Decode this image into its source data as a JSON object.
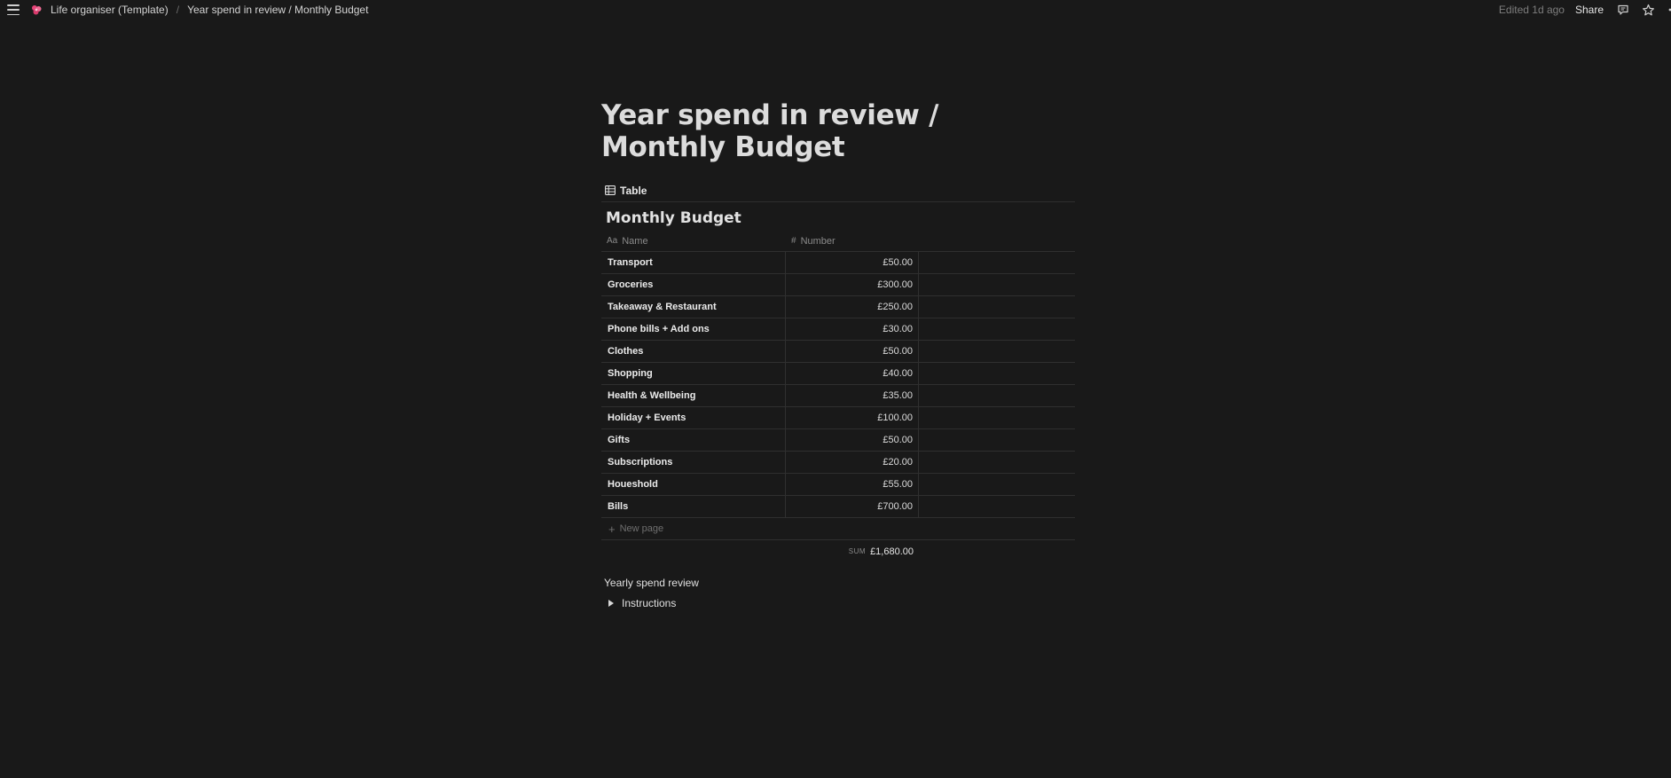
{
  "topbar": {
    "workspace_page": "Life organiser (Template)",
    "separator": "/",
    "current_page": "Year spend in review / Monthly Budget",
    "edited": "Edited 1d ago",
    "share_label": "Share",
    "icons": [
      "menu-icon",
      "page-emoji-icon",
      "comment-icon",
      "star-icon",
      "more-icon"
    ]
  },
  "page": {
    "title": "Year spend in review / Monthly Budget",
    "view_tab": "Table",
    "database_title": "Monthly Budget"
  },
  "table": {
    "columns": [
      {
        "icon": "Aa",
        "label": "Name"
      },
      {
        "icon": "#",
        "label": "Number"
      }
    ],
    "rows": [
      {
        "name": "Transport",
        "number": "£50.00"
      },
      {
        "name": "Groceries",
        "number": "£300.00"
      },
      {
        "name": "Takeaway & Restaurant",
        "number": "£250.00"
      },
      {
        "name": "Phone bills + Add ons",
        "number": "£30.00"
      },
      {
        "name": "Clothes",
        "number": "£50.00"
      },
      {
        "name": "Shopping",
        "number": "£40.00"
      },
      {
        "name": "Health & Wellbeing",
        "number": "£35.00"
      },
      {
        "name": "Holiday + Events",
        "number": "£100.00"
      },
      {
        "name": "Gifts",
        "number": "£50.00"
      },
      {
        "name": "Subscriptions",
        "number": "£20.00"
      },
      {
        "name": "Houeshold",
        "number": "£55.00"
      },
      {
        "name": "Bills",
        "number": "£700.00"
      }
    ],
    "new_page_label": "New page",
    "sum_label": "SUM",
    "sum_value": "£1,680.00"
  },
  "below": {
    "yearly_text": "Yearly spend review",
    "toggle_label": "Instructions"
  },
  "colors": {
    "background": "#191919",
    "text": "#d4d4d4",
    "border": "#2f2f2f",
    "emoji_accent": "#e8457a"
  }
}
